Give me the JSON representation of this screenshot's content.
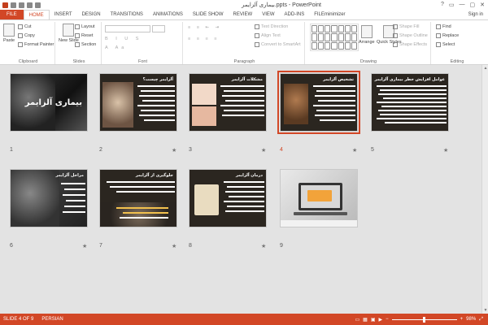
{
  "window": {
    "title": "بیماری آلزایمر.ppts - PowerPoint",
    "controls": [
      "?",
      "▭",
      "—",
      "▢",
      "✕"
    ]
  },
  "ribbon_tabs": [
    "FILE",
    "HOME",
    "INSERT",
    "DESIGN",
    "TRANSITIONS",
    "ANIMATIONS",
    "SLIDE SHOW",
    "REVIEW",
    "VIEW",
    "ADD-INS",
    "FILEminimizer"
  ],
  "user": "Sign in",
  "groups": {
    "clipboard": {
      "label": "Clipboard",
      "paste": "Paste",
      "cut": "Cut",
      "copy": "Copy",
      "format_painter": "Format Painter"
    },
    "slides": {
      "label": "Slides",
      "new_slide": "New Slide",
      "layout": "Layout",
      "reset": "Reset",
      "section": "Section"
    },
    "font": {
      "label": "Font"
    },
    "paragraph": {
      "label": "Paragraph",
      "text_direction": "Text Direction",
      "align_text": "Align Text",
      "convert": "Convert to SmartArt"
    },
    "drawing": {
      "label": "Drawing",
      "arrange": "Arrange",
      "quick_styles": "Quick Styles",
      "shape_fill": "Shape Fill",
      "shape_outline": "Shape Outline",
      "shape_effects": "Shape Effects"
    },
    "editing": {
      "label": "Editing",
      "find": "Find",
      "replace": "Replace",
      "select": "Select"
    }
  },
  "slides": [
    {
      "num": "1",
      "title": "بیماری آلزایمر",
      "star": ""
    },
    {
      "num": "2",
      "title": "آلزایمر چیست؟",
      "star": "★"
    },
    {
      "num": "3",
      "title": "مشکلات آلزایمر",
      "star": "★"
    },
    {
      "num": "4",
      "title": "تشخیص آلزایمر",
      "star": "★"
    },
    {
      "num": "5",
      "title": "عوامل افزایش خطر بیماری آلزایمر",
      "star": "★"
    },
    {
      "num": "6",
      "title": "مراحل آلزایمر",
      "star": "★"
    },
    {
      "num": "7",
      "title": "جلوگیری از آلزایمر",
      "star": "★"
    },
    {
      "num": "8",
      "title": "درمان آلزایمر",
      "star": "★"
    },
    {
      "num": "9",
      "title": "",
      "star": ""
    }
  ],
  "status": {
    "slide": "SLIDE 4 OF 9",
    "language": "PERSIAN",
    "zoom": "98%"
  },
  "colors": {
    "accent": "#d24726",
    "slide_bg": "#2a2520"
  }
}
